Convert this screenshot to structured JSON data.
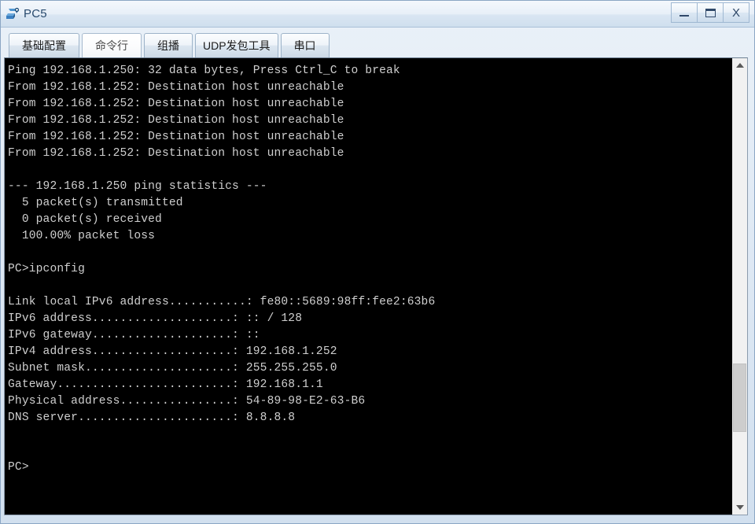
{
  "window": {
    "title": "PC5",
    "icon": "pc-device-icon",
    "controls": {
      "minimize_label": "—",
      "maximize_label": "❐",
      "close_label": "X"
    }
  },
  "tabs": [
    {
      "label": "基础配置",
      "active": false,
      "name": "tab-basic-config"
    },
    {
      "label": "命令行",
      "active": true,
      "name": "tab-command-line"
    },
    {
      "label": "组播",
      "active": false,
      "name": "tab-multicast"
    },
    {
      "label": "UDP发包工具",
      "active": false,
      "name": "tab-udp-tool"
    },
    {
      "label": "串口",
      "active": false,
      "name": "tab-serial-port"
    }
  ],
  "terminal": {
    "background_color": "#000000",
    "text_color": "#cfcfcf",
    "lines": [
      "Ping 192.168.1.250: 32 data bytes, Press Ctrl_C to break",
      "From 192.168.1.252: Destination host unreachable",
      "From 192.168.1.252: Destination host unreachable",
      "From 192.168.1.252: Destination host unreachable",
      "From 192.168.1.252: Destination host unreachable",
      "From 192.168.1.252: Destination host unreachable",
      "",
      "--- 192.168.1.250 ping statistics ---",
      "  5 packet(s) transmitted",
      "  0 packet(s) received",
      "  100.00% packet loss",
      "",
      "PC>ipconfig",
      "",
      "Link local IPv6 address...........: fe80::5689:98ff:fee2:63b6",
      "IPv6 address....................: :: / 128",
      "IPv6 gateway....................: ::",
      "IPv4 address....................: 192.168.1.252",
      "Subnet mask.....................: 255.255.255.0",
      "Gateway.........................: 192.168.1.1",
      "Physical address................: 54-89-98-E2-63-B6",
      "DNS server......................: 8.8.8.8",
      "",
      "",
      "PC>"
    ]
  },
  "scrollbar": {
    "up_arrow": "scroll-up",
    "down_arrow": "scroll-down",
    "thumb_top_pct": 68,
    "thumb_height_pct": 16
  }
}
